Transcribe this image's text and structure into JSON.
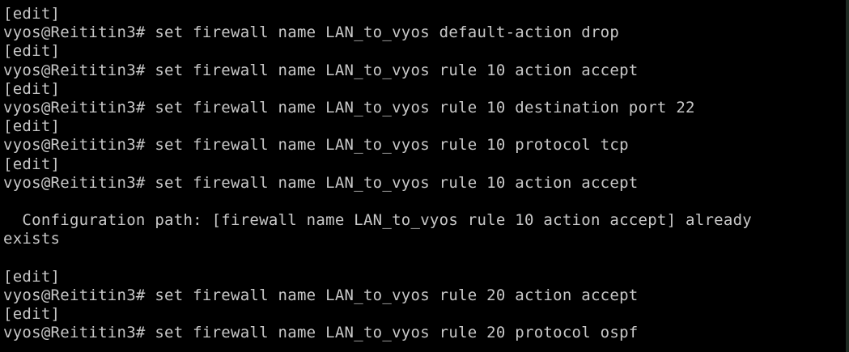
{
  "terminal": {
    "lines": [
      "[edit]",
      "vyos@Reititin3# set firewall name LAN_to_vyos default-action drop",
      "[edit]",
      "vyos@Reititin3# set firewall name LAN_to_vyos rule 10 action accept",
      "[edit]",
      "vyos@Reititin3# set firewall name LAN_to_vyos rule 10 destination port 22",
      "[edit]",
      "vyos@Reititin3# set firewall name LAN_to_vyos rule 10 protocol tcp",
      "[edit]",
      "vyos@Reititin3# set firewall name LAN_to_vyos rule 10 action accept",
      "",
      "  Configuration path: [firewall name LAN_to_vyos rule 10 action accept] already",
      "exists",
      "",
      "[edit]",
      "vyos@Reititin3# set firewall name LAN_to_vyos rule 20 action accept",
      "[edit]",
      "vyos@Reititin3# set firewall name LAN_to_vyos rule 20 protocol ospf"
    ]
  }
}
